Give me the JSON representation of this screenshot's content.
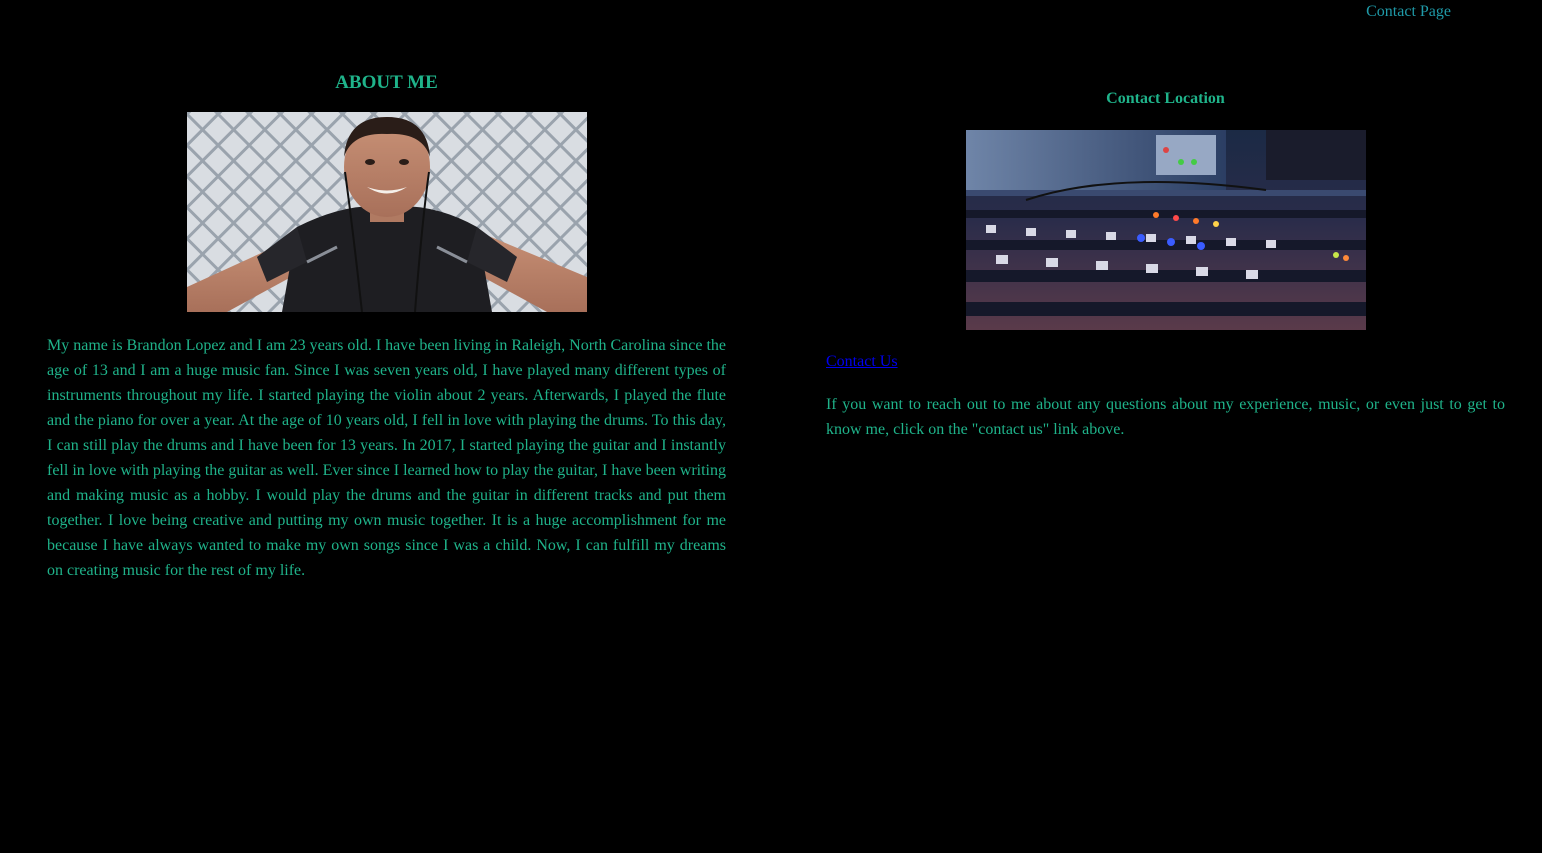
{
  "nav": {
    "contact_page_label": "Contact Page"
  },
  "about": {
    "title": "ABOUT ME",
    "photo_alt": "selfie-photo",
    "text": "My name is Brandon Lopez and I am 23 years old. I have been living in Raleigh, North Carolina since the age of 13 and I am a huge music fan. Since I was seven years old, I have played many different types of instruments throughout my life. I started playing the violin about 2 years. Afterwards, I played the flute and the piano for over a year. At the age of 10 years old, I fell in love with playing the drums. To this day, I can still play the drums and I have been for 13 years. In 2017, I started playing the guitar and I instantly fell in love with playing the guitar as well. Ever since I learned how to play the guitar, I have been writing and making music as a hobby. I would play the drums and the guitar in different tracks and put them together. I love being creative and putting my own music together. It is a huge accomplishment for me because I have always wanted to make my own songs since I was a child. Now, I can fulfill my dreams on creating music for the rest of my life."
  },
  "contact": {
    "title": "Contact Location",
    "image_alt": "mixing-console-photo",
    "link_label": "Contact Us",
    "text": "If you want to reach out to me about any questions about my experience, music, or even just to get to know me, click on the \"contact us\" link above."
  },
  "colors": {
    "background": "#000000",
    "text": "#1fb38a",
    "nav_link": "#1f9aa8",
    "link": "#0000ee"
  }
}
